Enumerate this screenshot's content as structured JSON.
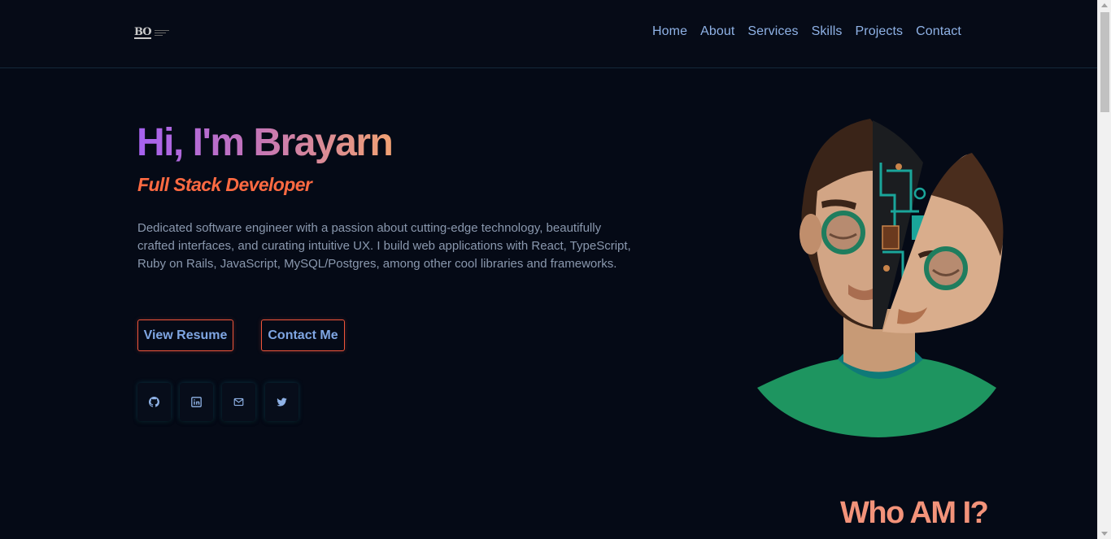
{
  "header": {
    "logo_text": "BO",
    "nav": [
      "Home",
      "About",
      "Services",
      "Skills",
      "Projects",
      "Contact"
    ]
  },
  "hero": {
    "title": "Hi, I'm Brayarn",
    "subtitle": "Full Stack Developer",
    "description": "Dedicated software engineer with a passion about cutting-edge technology, beautifully crafted interfaces, and curating intuitive UX. I build web applications with React, TypeScript, Ruby on Rails, JavaScript, MySQL/Postgres, among other cool libraries and frameworks.",
    "buttons": {
      "resume": "View Resume",
      "contact": "Contact Me"
    },
    "socials": [
      "github-icon",
      "linkedin-icon",
      "mail-icon",
      "twitter-icon"
    ]
  },
  "about": {
    "heading": "Who AM I?"
  },
  "colors": {
    "background": "#050a16",
    "accent_orange": "#ff6a42",
    "nav_blue": "#8fb2e6",
    "gradient_start": "#a561f0",
    "gradient_end": "#f1a174"
  }
}
